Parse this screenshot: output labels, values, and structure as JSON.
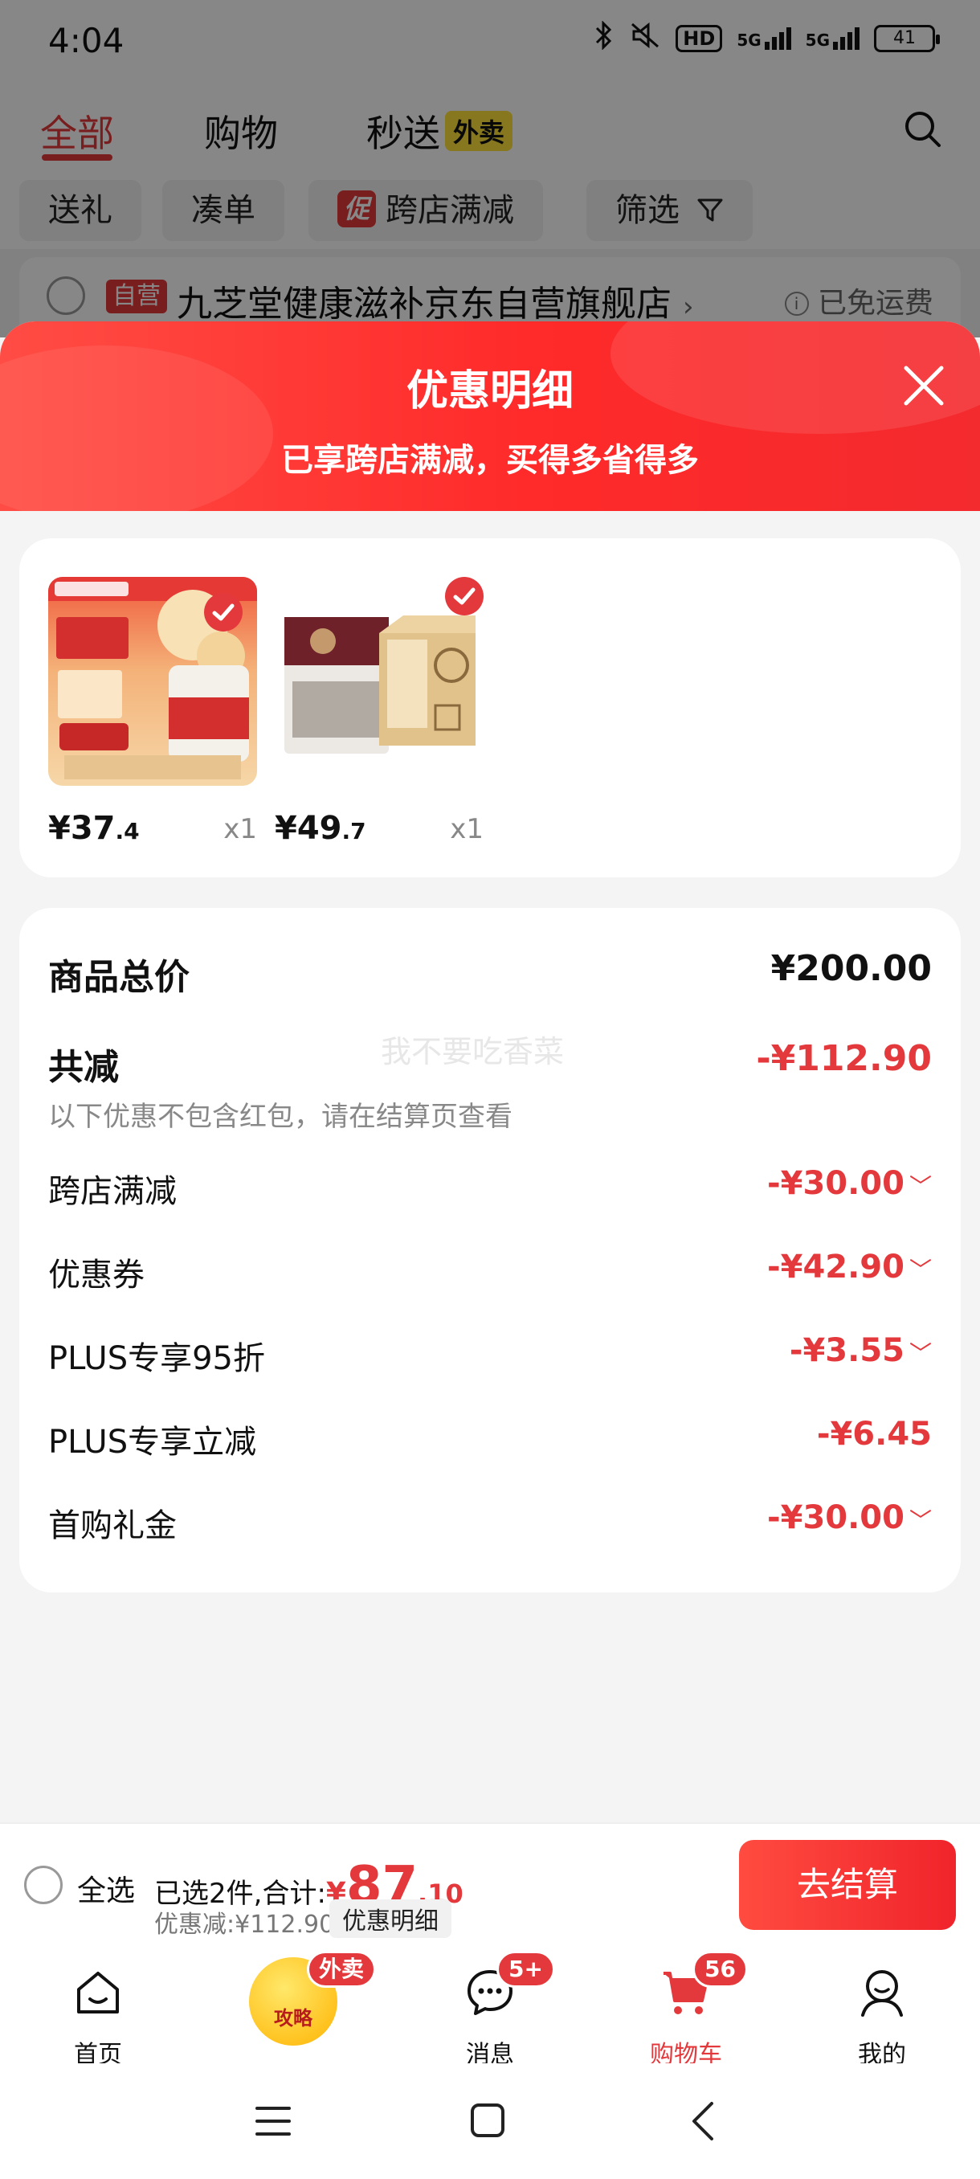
{
  "status_bar": {
    "time": "4:04",
    "hd": "HD",
    "network1": "5G",
    "network2": "5G",
    "battery": "41"
  },
  "top_tabs": {
    "all": "全部",
    "shopping": "购物",
    "flash": "秒送",
    "flash_badge": "外卖"
  },
  "filters": {
    "gift": "送礼",
    "bundle": "凑单",
    "promo_tag": "促",
    "cross_store": "跨店满减",
    "filter": "筛选"
  },
  "store": {
    "self_tag": "自营",
    "name": "九芝堂健康滋补京东自营旗舰店",
    "shipping": "已免运费"
  },
  "sheet": {
    "title": "优惠明细",
    "subtitle": "已享跨店满减，买得多省得多",
    "products": [
      {
        "price_int": "¥37",
        "price_dec": ".4",
        "qty": "x1"
      },
      {
        "price_int": "¥49",
        "price_dec": ".7",
        "qty": "x1"
      }
    ],
    "total_label": "商品总价",
    "total_value": "¥200.00",
    "reduce_label": "共减",
    "reduce_value": "-¥112.90",
    "note": "以下优惠不包含红包，请在结算页查看",
    "watermark": "我不要吃香菜",
    "discounts": [
      {
        "label": "跨店满减",
        "value": "-¥30.00"
      },
      {
        "label": "优惠券",
        "value": "-¥42.90"
      },
      {
        "label": "PLUS专享95折",
        "value": "-¥3.55"
      },
      {
        "label": "PLUS专享立减",
        "value": "-¥6.45"
      },
      {
        "label": "首购礼金",
        "value": "-¥30.00"
      }
    ]
  },
  "checkout": {
    "select_all": "全选",
    "selected_text": "已选2件,合计:",
    "currency": "¥",
    "total_int": "87",
    "total_dec": ".10",
    "discount_text": "优惠减:¥112.90",
    "detail_button": "优惠明细",
    "checkout_button": "去结算"
  },
  "tabbar": {
    "home": "首页",
    "strategy": "攻略",
    "strategy_badge": "外卖",
    "messages": "消息",
    "messages_badge": "5+",
    "cart": "购物车",
    "cart_badge": "56",
    "me": "我的"
  },
  "colors": {
    "accent": "#e4393c",
    "header_start": "#ff4c44",
    "header_end": "#f32a2e"
  }
}
